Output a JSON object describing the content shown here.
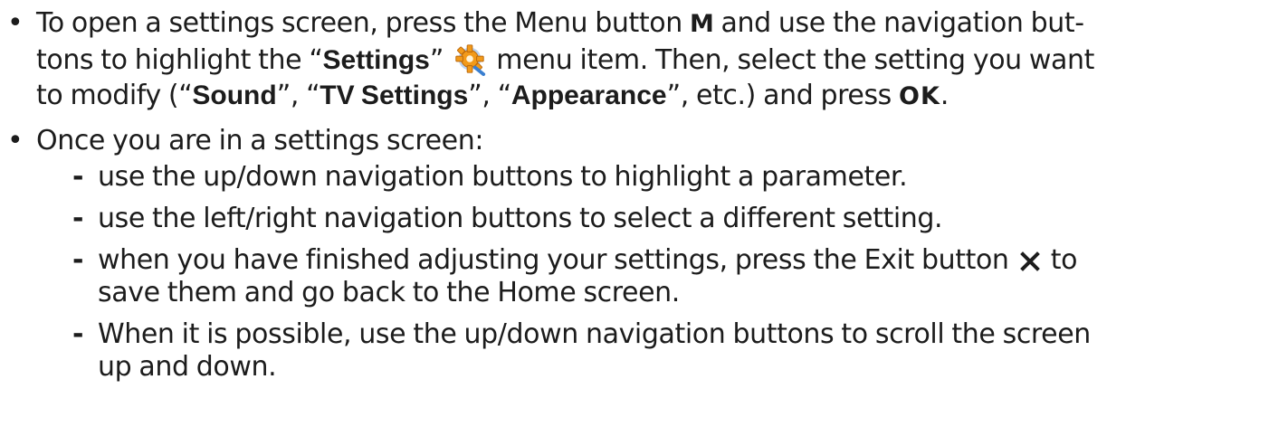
{
  "bullet_glyph": "•",
  "dash_glyph": "-",
  "item1": {
    "l1_a": "To open a settings screen, press the Menu button ",
    "l1_key": "M",
    "l1_b": " and use the navigation but-",
    "l2_a": "tons to highlight the “",
    "l2_settings": "Settings",
    "l2_b": "” ",
    "l2_icon": "settings-gear-icon",
    "l2_c": " menu item. Then, select the setting you want",
    "l3_a": "to modify (“",
    "l3_sound": "Sound",
    "l3_b": "”, “",
    "l3_tv": "TV Settings",
    "l3_c": "”, “",
    "l3_appearance": "Appearance",
    "l3_d": "”, etc.) and press ",
    "l3_ok": "OK",
    "l3_e": "."
  },
  "item2": {
    "text": "Once you are in a settings screen:"
  },
  "sub1": {
    "text": "use the up/down navigation buttons to highlight a parameter."
  },
  "sub2": {
    "text": "use the left/right navigation buttons to select a different setting."
  },
  "sub3": {
    "l1_a": "when you have finished adjusting your settings, press the Exit button ",
    "l1_icon": "exit-x-icon",
    "l1_b": " to",
    "l2": "save them and go back to the Home screen."
  },
  "sub4": {
    "l1": "When it is possible, use the up/down navigation buttons to scroll the screen",
    "l2": "up and down."
  },
  "colors": {
    "text": "#1c1c1c",
    "gear_orange": "#f29a1a",
    "gear_blue": "#3a7fd0"
  }
}
